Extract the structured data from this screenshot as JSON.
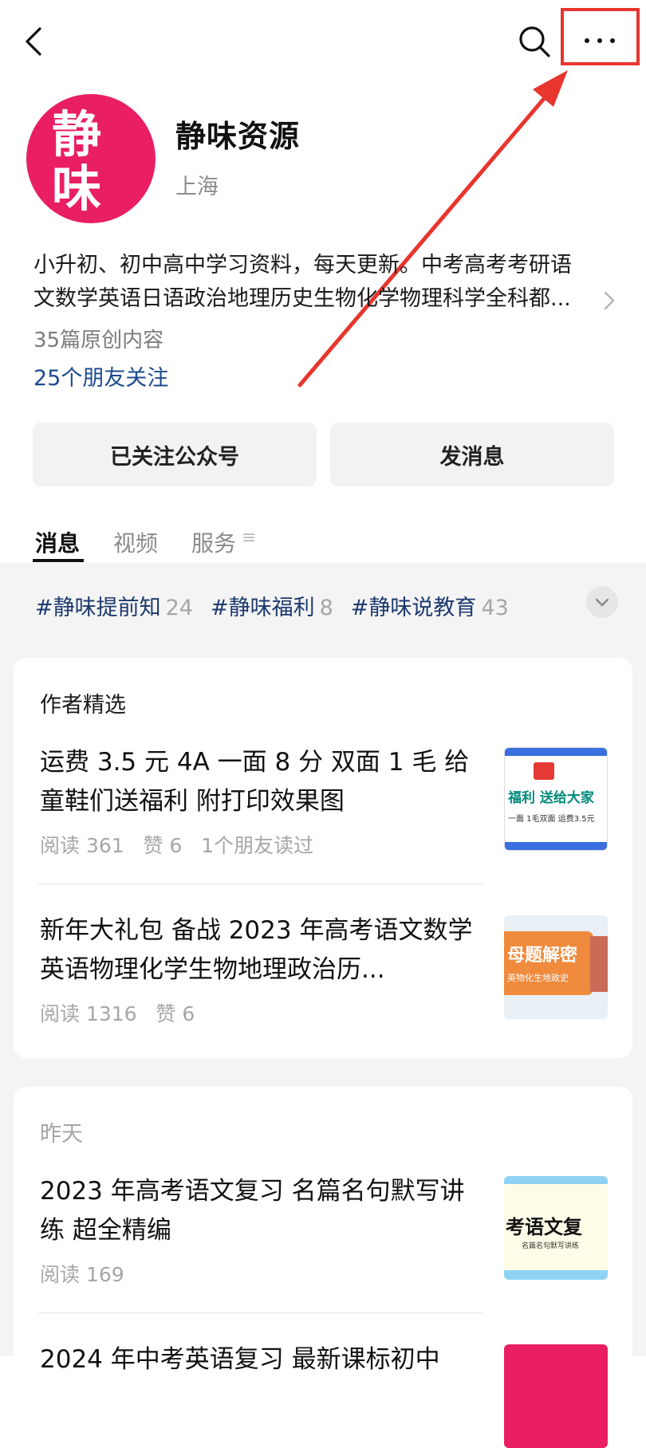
{
  "profile": {
    "avatar_chars": [
      "静",
      "味"
    ],
    "name": "静味资源",
    "location": "上海",
    "bio": "小升初、初中高中学习资料，每天更新。中考高考考研语文数学英语日语政治地理历史生物化学物理科学全科都...",
    "original_count": "35篇原创内容",
    "friends_following": "25个朋友关注"
  },
  "buttons": {
    "followed": "已关注公众号",
    "message": "发消息"
  },
  "tabs": [
    {
      "label": "消息",
      "active": true
    },
    {
      "label": "视频",
      "active": false
    },
    {
      "label": "服务",
      "active": false
    }
  ],
  "tab_extra": "≡",
  "tags": [
    {
      "name": "#静味提前知",
      "count": "24"
    },
    {
      "name": "#静味福利",
      "count": "8"
    },
    {
      "name": "#静味说教育",
      "count": "43"
    }
  ],
  "featured": {
    "title": "作者精选",
    "articles": [
      {
        "title": "运费 3.5 元 4A 一面 8 分 双面 1 毛 给童鞋们送福利 附打印效果图",
        "meta": "阅读 361   赞 6   1个朋友读过",
        "thumb_text": "福利  送给大家",
        "thumb_sub": "一面 1毛双面  运费3.5元"
      },
      {
        "title": "新年大礼包 备战 2023 年高考语文数学英语物理化学生物地理政治历...",
        "meta": "阅读 1316   赞 6",
        "thumb_text": "母题解密",
        "thumb_sub": "英物化生地政史"
      }
    ]
  },
  "yesterday": {
    "title": "昨天",
    "articles": [
      {
        "title": "2023 年高考语文复习 名篇名句默写讲练 超全精编",
        "meta": "阅读 169",
        "thumb_text": "考语文复",
        "thumb_sub": "名篇名句默写讲练"
      },
      {
        "title": "2024 年中考英语复习 最新课标初中",
        "meta": ""
      }
    ]
  },
  "colors": {
    "accent_red": "#e8352e",
    "avatar_bg": "#e91e63",
    "link_blue": "#1d4a8f"
  }
}
